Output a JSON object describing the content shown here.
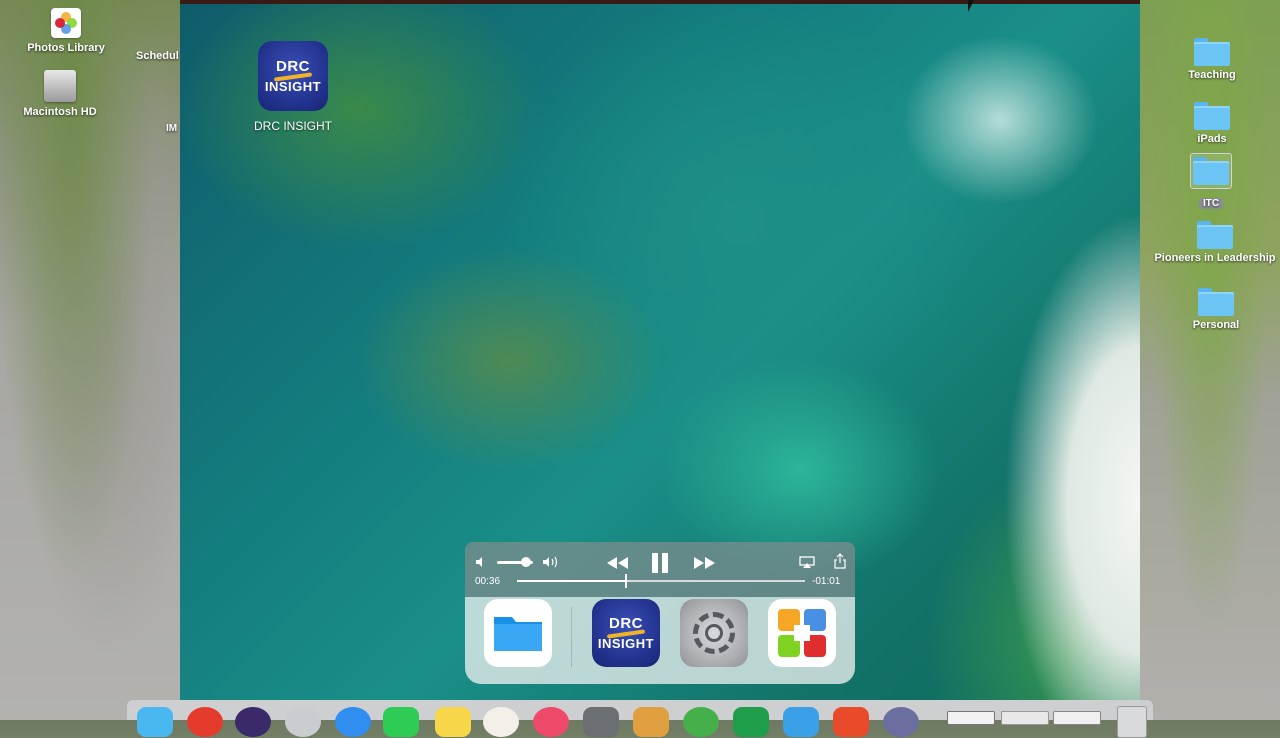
{
  "desktop_left": {
    "items": [
      {
        "label": "Photos Library",
        "icon": "photos-icon"
      },
      {
        "label": "Macintosh HD",
        "icon": "hard-drive-icon"
      }
    ],
    "partial_labels": [
      "Schedul",
      "IM"
    ]
  },
  "desktop_right": {
    "folders": [
      {
        "label": "Teaching"
      },
      {
        "label": "iPads"
      },
      {
        "label": "ITC"
      },
      {
        "label": "Pioneers in Leadership"
      },
      {
        "label": "Personal"
      }
    ]
  },
  "ipad": {
    "home_app": {
      "label": "DRC INSIGHT",
      "logo_line1": "DRC",
      "logo_line2": "INSIGHT"
    },
    "media_controls": {
      "elapsed": "00:36",
      "remaining": "-01:01",
      "progress": 0.38,
      "volume": 0.8,
      "icons": [
        "speaker-low-icon",
        "speaker-high-icon",
        "rewind-icon",
        "pause-icon",
        "fast-forward-icon",
        "airplay-icon",
        "share-icon"
      ]
    },
    "dock": [
      {
        "name": "Files",
        "icon": "files-icon"
      },
      {
        "name": "DRC INSIGHT",
        "icon": "drc-insight-icon",
        "logo_line1": "DRC",
        "logo_line2": "INSIGHT"
      },
      {
        "name": "Settings",
        "icon": "settings-icon"
      },
      {
        "name": "Apps",
        "icon": "app-grid-icon"
      }
    ]
  },
  "mac_dock": {
    "apps": [
      "finder-icon",
      "chrome-icon",
      "siri-icon",
      "launchpad-icon",
      "safari-icon",
      "facetime-icon",
      "notes-icon",
      "photos-icon",
      "music-icon",
      "preferences-icon",
      "app-icon",
      "maps-icon",
      "excel-icon",
      "twitter-icon",
      "screenflow-icon",
      "quicktime-icon",
      "window-icon",
      "window-icon",
      "window-icon",
      "trash-icon"
    ]
  },
  "colors": {
    "drc_blue": "#20308a",
    "drc_gold": "#f0b429",
    "folder_blue": "#6cc4f5"
  }
}
